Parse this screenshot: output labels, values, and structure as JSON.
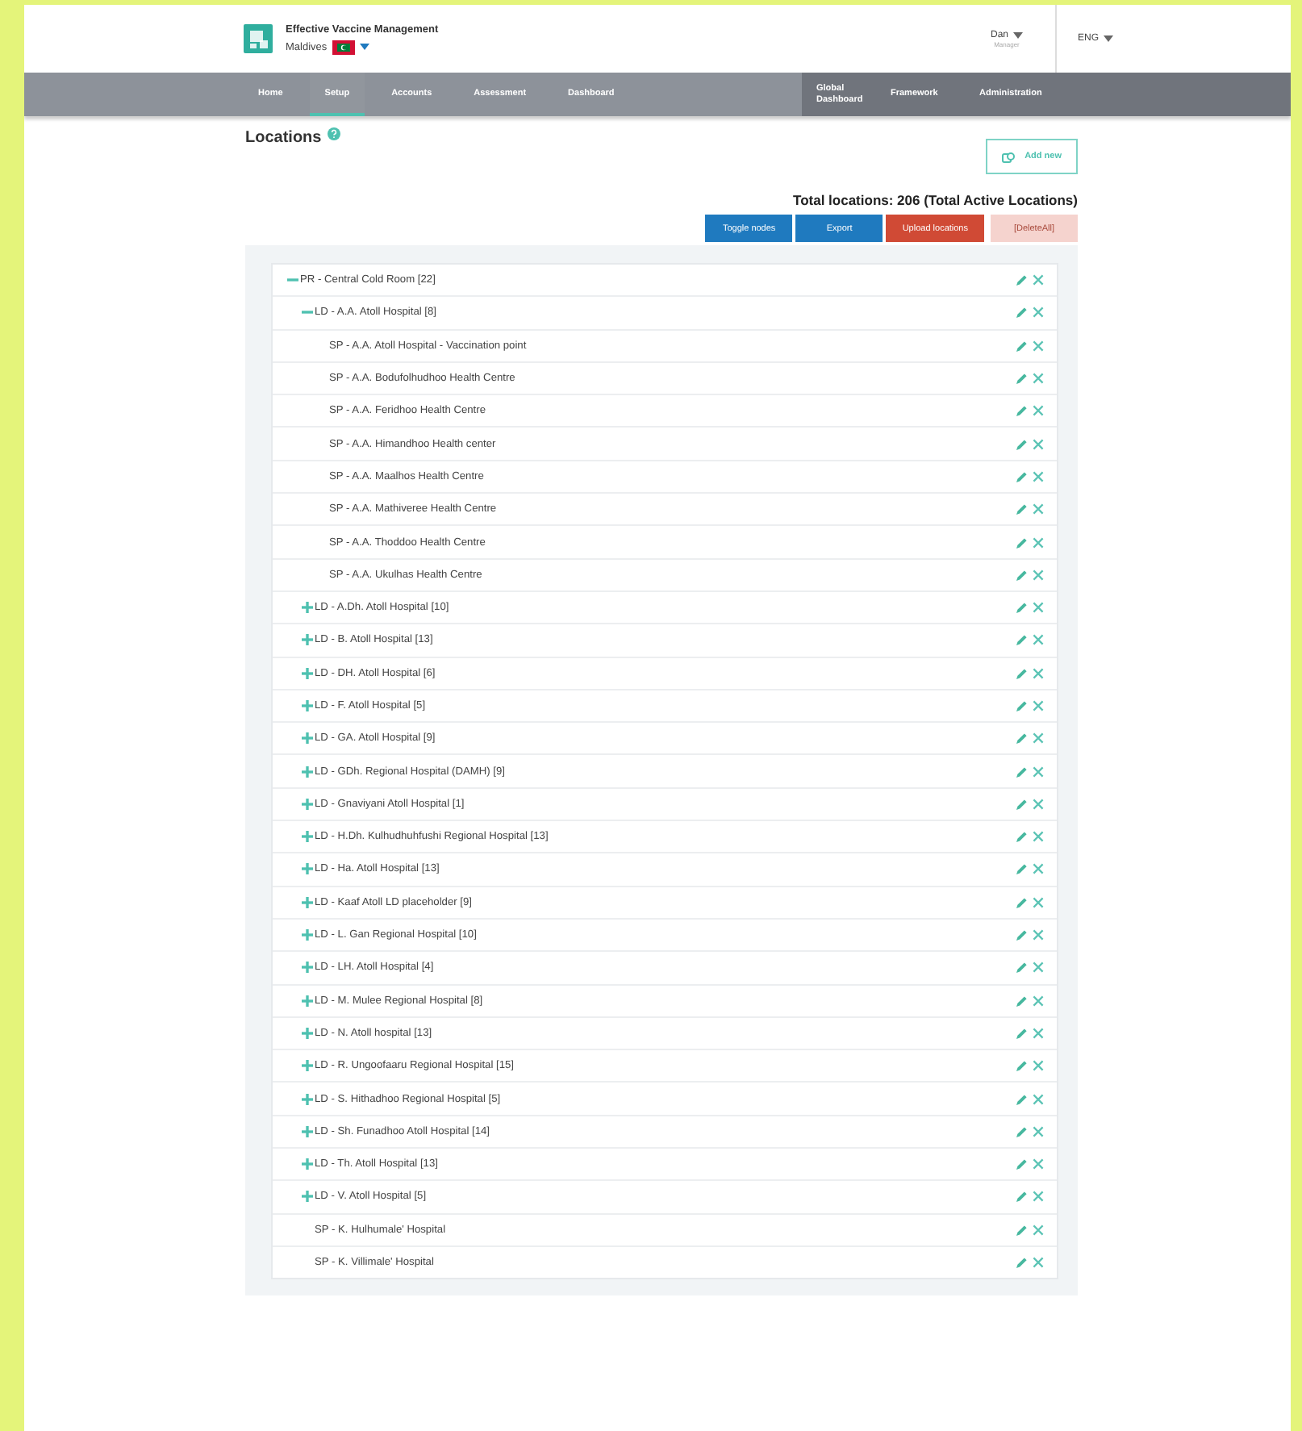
{
  "header": {
    "app_title": "Effective Vaccine Management",
    "country": "Maldives",
    "user": {
      "name": "Dan",
      "role": "Manager"
    },
    "language": "ENG"
  },
  "nav": {
    "main": [
      {
        "label": "Home",
        "selected": false
      },
      {
        "label": "Setup",
        "selected": true
      },
      {
        "label": "Accounts",
        "selected": false
      },
      {
        "label": "Assessment",
        "selected": false
      },
      {
        "label": "Dashboard",
        "selected": false
      }
    ],
    "secondary": [
      "Global Dashboard",
      "Framework",
      "Administration"
    ]
  },
  "page": {
    "title": "Locations",
    "add_button": "Add new",
    "total": "Total locations: 206 (Total Active Locations)",
    "actions": [
      {
        "label": "Toggle nodes",
        "kind": "primary",
        "disabled": false
      },
      {
        "label": "Export",
        "kind": "primary",
        "disabled": false
      },
      {
        "label": "Upload locations",
        "kind": "danger",
        "disabled": false
      },
      {
        "label": "[DeleteAll]",
        "kind": "danger",
        "disabled": true
      }
    ]
  },
  "tree": [
    {
      "label": "PR - Central Cold Room [22]",
      "kind": "group",
      "expanded": true,
      "children": [
        {
          "label": "LD - A.A. Atoll Hospital [8]",
          "kind": "group",
          "expanded": true,
          "children": [
            {
              "label": "SP - A.A. Atoll Hospital - Vaccination point",
              "kind": "point"
            },
            {
              "label": "SP - A.A. Bodufolhudhoo Health Centre",
              "kind": "point"
            },
            {
              "label": "SP - A.A. Feridhoo Health Centre",
              "kind": "point"
            },
            {
              "label": "SP - A.A. Himandhoo Health center",
              "kind": "point"
            },
            {
              "label": "SP - A.A. Maalhos Health Centre",
              "kind": "point"
            },
            {
              "label": "SP - A.A. Mathiveree Health Centre",
              "kind": "point"
            },
            {
              "label": "SP - A.A. Thoddoo Health Centre",
              "kind": "point"
            },
            {
              "label": "SP - A.A. Ukulhas Health Centre",
              "kind": "point"
            }
          ]
        },
        {
          "label": "LD - A.Dh. Atoll Hospital [10]",
          "kind": "group",
          "expanded": false
        },
        {
          "label": "LD - B. Atoll Hospital [13]",
          "kind": "group",
          "expanded": false
        },
        {
          "label": "LD - DH. Atoll Hospital [6]",
          "kind": "group",
          "expanded": false
        },
        {
          "label": "LD - F. Atoll Hospital [5]",
          "kind": "group",
          "expanded": false
        },
        {
          "label": "LD - GA. Atoll Hospital [9]",
          "kind": "group",
          "expanded": false
        },
        {
          "label": "LD - GDh. Regional Hospital (DAMH) [9]",
          "kind": "group",
          "expanded": false
        },
        {
          "label": "LD - Gnaviyani Atoll Hospital [1]",
          "kind": "group",
          "expanded": false
        },
        {
          "label": "LD - H.Dh. Kulhudhuhfushi Regional Hospital [13]",
          "kind": "group",
          "expanded": false
        },
        {
          "label": "LD - Ha. Atoll Hospital [13]",
          "kind": "group",
          "expanded": false
        },
        {
          "label": "LD - Kaaf Atoll LD placeholder [9]",
          "kind": "group",
          "expanded": false
        },
        {
          "label": "LD - L. Gan Regional Hospital [10]",
          "kind": "group",
          "expanded": false
        },
        {
          "label": "LD - LH. Atoll Hospital [4]",
          "kind": "group",
          "expanded": false
        },
        {
          "label": "LD - M. Mulee Regional Hospital [8]",
          "kind": "group",
          "expanded": false
        },
        {
          "label": "LD - N. Atoll hospital [13]",
          "kind": "group",
          "expanded": false
        },
        {
          "label": "LD - R. Ungoofaaru Regional Hospital [15]",
          "kind": "group",
          "expanded": false
        },
        {
          "label": "LD - S. Hithadhoo Regional Hospital [5]",
          "kind": "group",
          "expanded": false
        },
        {
          "label": "LD - Sh. Funadhoo Atoll Hospital [14]",
          "kind": "group",
          "expanded": false
        },
        {
          "label": "LD - Th. Atoll Hospital [13]",
          "kind": "group",
          "expanded": false
        },
        {
          "label": "LD - V. Atoll Hospital [5]",
          "kind": "group",
          "expanded": false
        },
        {
          "label": "SP - K. Hulhumale' Hospital",
          "kind": "point"
        },
        {
          "label": "SP - K. Villimale' Hospital",
          "kind": "point"
        }
      ]
    }
  ]
}
